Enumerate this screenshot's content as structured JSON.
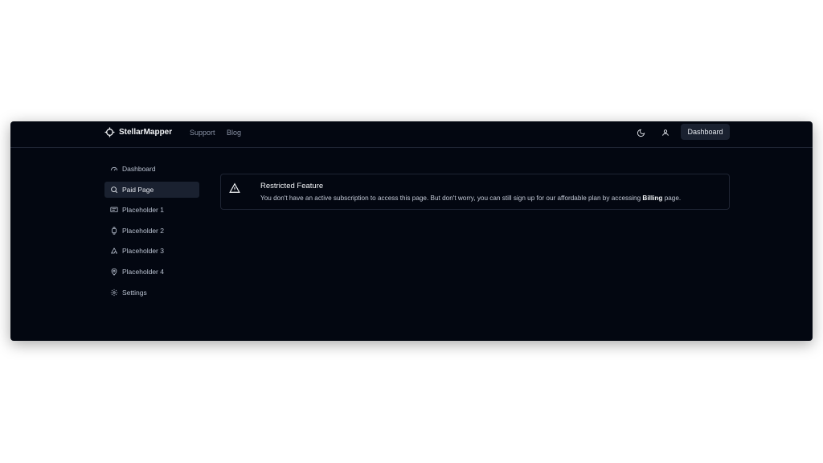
{
  "brand": {
    "name": "StellarMapper",
    "icon": "stellar-logo-icon"
  },
  "nav": {
    "support": "Support",
    "blog": "Blog"
  },
  "header": {
    "theme_icon": "moon-icon",
    "user_icon": "user-icon",
    "dashboard_button": "Dashboard"
  },
  "sidebar": {
    "items": [
      {
        "label": "Dashboard",
        "icon": "gauge-icon",
        "active": false
      },
      {
        "label": "Paid Page",
        "icon": "search-icon",
        "active": true
      },
      {
        "label": "Placeholder 1",
        "icon": "monitor-icon",
        "active": false
      },
      {
        "label": "Placeholder 2",
        "icon": "watch-icon",
        "active": false
      },
      {
        "label": "Placeholder 3",
        "icon": "recycle-icon",
        "active": false
      },
      {
        "label": "Placeholder 4",
        "icon": "map-pin-icon",
        "active": false
      },
      {
        "label": "Settings",
        "icon": "gear-icon",
        "active": false
      }
    ]
  },
  "alert": {
    "icon": "warning-triangle-icon",
    "title": "Restricted Feature",
    "text_before": "You don't have an active subscription to access this page. But don't worry, you can still sign up for our affordable plan by accessing ",
    "link": "Billing",
    "text_after": " page."
  },
  "colors": {
    "background": "#030711",
    "border": "#1e2433",
    "active": "#1a2130",
    "text": "#f2f4f7",
    "muted": "#8a93a6"
  }
}
